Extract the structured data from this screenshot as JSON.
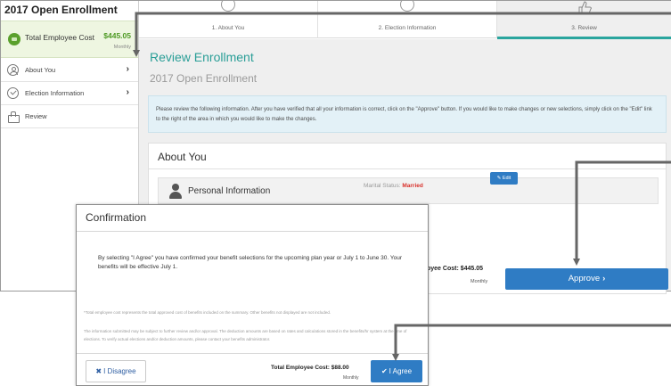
{
  "sidebar": {
    "title": "2017 Open Enrollment",
    "cost_label": "Total Employee Cost",
    "cost_amount": "$445.05",
    "cost_period": "Monthly",
    "items": [
      {
        "label": "About You",
        "chevron": "›",
        "icon": "person-icon"
      },
      {
        "label": "Election Information",
        "chevron": "›",
        "icon": "check-circle-icon"
      },
      {
        "label": "Review",
        "icon": "thumbs-up-icon"
      }
    ]
  },
  "steps": [
    {
      "label": "1. About You",
      "icon": "person-icon"
    },
    {
      "label": "2. Election Information",
      "icon": "check-circle-icon"
    },
    {
      "label": "3. Review",
      "icon": "thumbs-up-icon",
      "active": true
    }
  ],
  "main": {
    "title": "Review Enrollment",
    "subtitle": "2017 Open Enrollment",
    "info_text": "Please review the following information. After you have verified that all your information is correct, click on the \"Approve\" button. If you would like to make changes or new selections, simply click on the \"Edit\" link to the right of the area in which you would like to make the changes.",
    "about_title": "About You",
    "personal_info_label": "Personal Information",
    "marital_label": "Marital Status:",
    "marital_value": "Married",
    "edit_label": "Edit",
    "employee_cost_label": "oyee Cost: $445.05",
    "employee_cost_period": "Monthly",
    "approve_label": "Approve",
    "approve_chevron": "›"
  },
  "modal": {
    "title": "Confirmation",
    "body": "By selecting \"I Agree\" you have confirmed your benefit selections for the upcoming plan year or July 1 to June 30.  Your benefits will be effective July 1.",
    "note1": "*Total employee cost represents the total approved cost of benefits included on the summary. Other benefits not displayed are not included.",
    "note2": "The information submitted may be subject to further review and/or approval. The deduction amounts are based on rates and calculations stored in the benefits/hr system at the time of elections. To verify actual elections and/or deduction amounts, please contact your benefits administrator.",
    "disagree_label": "I Disagree",
    "total_cost_label": "Total Employee Cost: $88.00",
    "total_cost_period": "Monthly",
    "agree_label": "I Agree"
  },
  "colors": {
    "accent_teal": "#2a9e97",
    "button_blue": "#2f7cc4",
    "cost_green": "#4e9a24",
    "married_red": "#d9302a"
  }
}
